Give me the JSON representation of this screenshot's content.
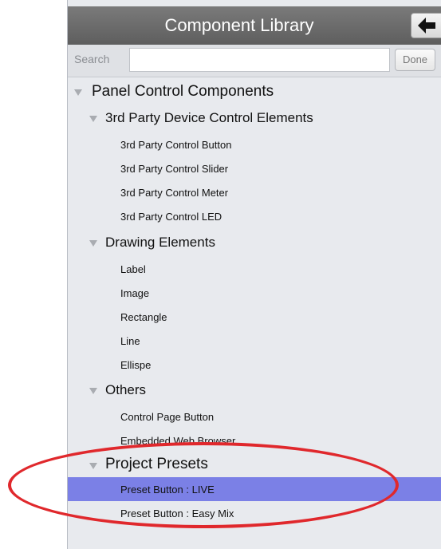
{
  "header": {
    "title": "Component Library"
  },
  "search": {
    "label": "Search",
    "value": "",
    "placeholder": "",
    "done_label": "Done"
  },
  "tree": {
    "root": "Panel Control Components",
    "groups": [
      {
        "label": "3rd Party Device Control Elements",
        "items": [
          "3rd Party Control Button",
          "3rd Party Control Slider",
          "3rd Party Control Meter",
          "3rd Party Control LED"
        ]
      },
      {
        "label": "Drawing Elements",
        "items": [
          "Label",
          "Image",
          "Rectangle",
          "Line",
          "Ellispe"
        ]
      },
      {
        "label": "Others",
        "items": [
          "Control Page Button",
          "Embedded Web Browser"
        ]
      }
    ],
    "presets": {
      "label": "Project Presets",
      "items": [
        "Preset Button : LIVE",
        "Preset Button : Easy Mix"
      ],
      "selected_item": "Preset Button : LIVE"
    }
  },
  "colors": {
    "selection": "#7b80e6",
    "annotation": "#e0282c",
    "title_bar": "#6a6a6a"
  }
}
